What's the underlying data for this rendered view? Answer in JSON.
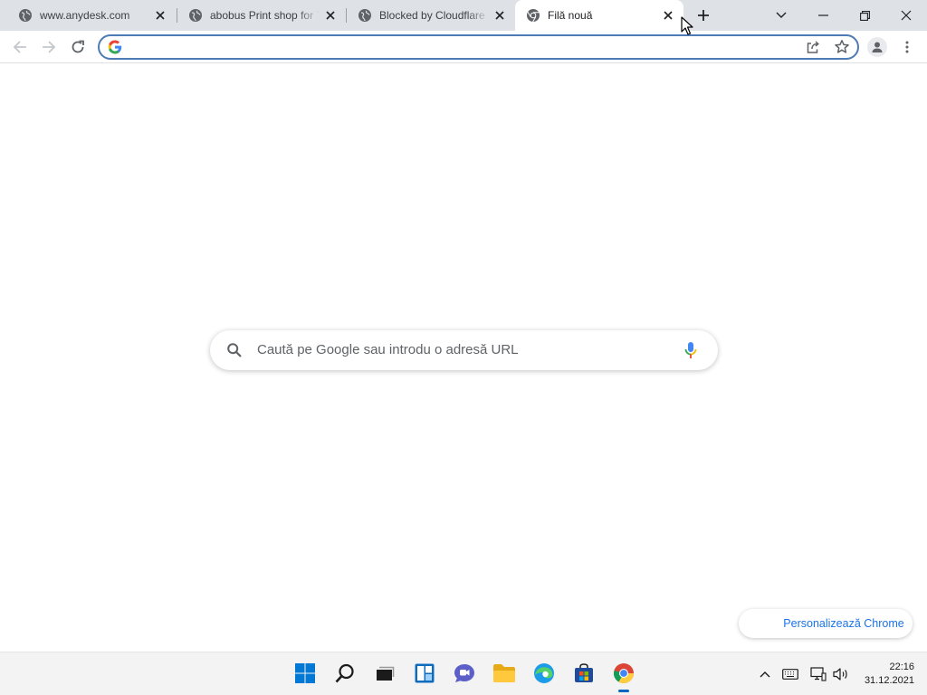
{
  "tabs": [
    {
      "title": "www.anydesk.com",
      "icon": "globe-icon"
    },
    {
      "title": "abobus Print shop for T",
      "icon": "globe-icon"
    },
    {
      "title": "Blocked by Cloudflare",
      "icon": "globe-icon"
    },
    {
      "title": "Filă nouă",
      "icon": "chrome-icon",
      "active": true
    }
  ],
  "omnibox": {
    "value": "",
    "placeholder": ""
  },
  "ntp": {
    "search_placeholder": "Caută pe Google sau introdu o adresă URL",
    "customize_label": "Personalizează Chrome"
  },
  "taskbar": {
    "apps": [
      "start-icon",
      "search-icon",
      "task-view-icon",
      "widgets-icon",
      "teams-chat-icon",
      "file-explorer-icon",
      "edge-icon",
      "store-icon",
      "chrome-icon"
    ],
    "clock": {
      "time": "22:16",
      "date": "31.12.2021"
    }
  },
  "colors": {
    "tabstrip": "#dee1e6",
    "omnibox_focus": "#4e7ab5",
    "link": "#1a73e8",
    "taskbar": "#f3f3f3"
  }
}
